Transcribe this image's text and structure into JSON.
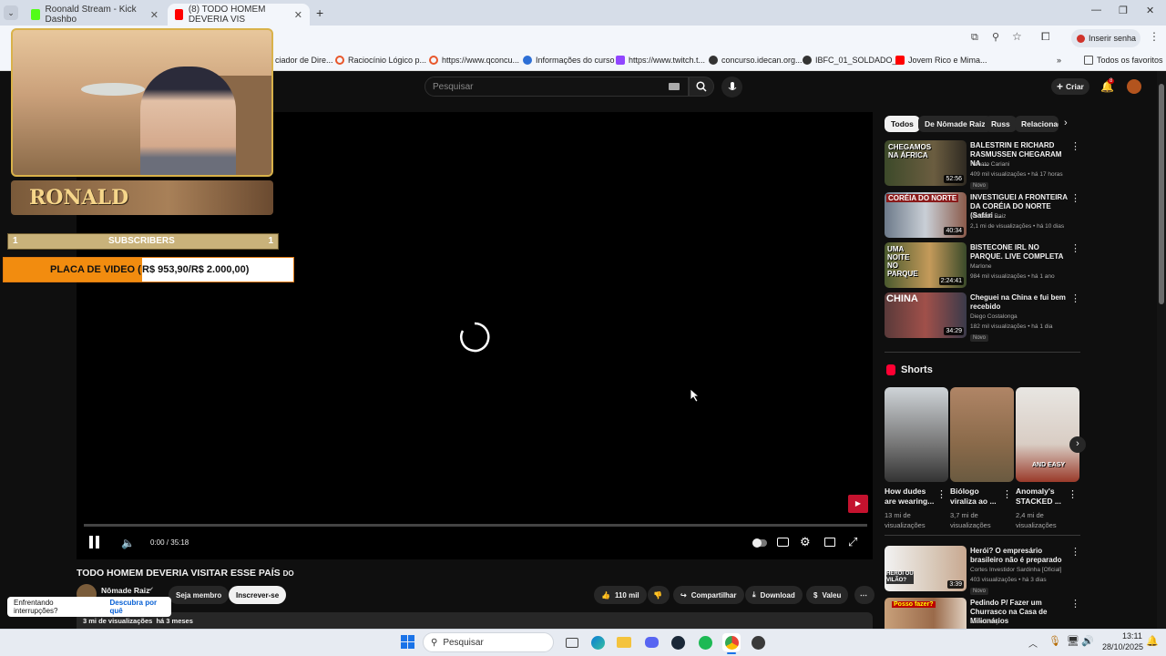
{
  "browser": {
    "tabs": [
      {
        "label": "Roonald Stream - Kick Dashbo",
        "active": false
      },
      {
        "label": "(8) TODO HOMEM DEVERIA VIS",
        "active": true
      }
    ],
    "new_tab": "+",
    "insert_password": "Inserir senha",
    "bookmarks": [
      "ciador de Dire...",
      "Raciocínio Lógico p...",
      "https://www.qconcu...",
      "Informações do curso",
      "https://www.twitch.t...",
      "concurso.idecan.org...",
      "IBFC_01_SOLDADO_...",
      "Jovem Rico e Mima..."
    ],
    "all_favorites": "Todos os favoritos",
    "more_bookmarks": "»"
  },
  "overlay": {
    "streamer_name": "RONALD",
    "subscribers_left": "1",
    "subscribers_label": "SUBSCRIBERS",
    "subscribers_right": "1",
    "goal_label": "PLACA DE VIDEO (",
    "goal_value": "R$ 953,90/R$ 2.000,00)",
    "goal_progress": 0.477
  },
  "youtube": {
    "search_placeholder": "Pesquisar",
    "create_label": "Criar",
    "notif_count": "8",
    "player": {
      "time": "0:00 / 35:18"
    },
    "video": {
      "title": "TODO HOMEM DEVERIA VISITAR ESSE PAÍS ",
      "title_suffix": "DO",
      "channel": "Nômade Raiz",
      "join": "Seja membro",
      "subscribe": "Inscrever-se",
      "likes": "110 mil",
      "share": "Compartilhar",
      "download": "Download",
      "thanks": "Valeu",
      "meta": "3 mi de visualizações  há 3 meses"
    },
    "toast": {
      "text": "Enfrentando interrupções?",
      "link": "Descubra por quê"
    },
    "chips": [
      "Todos",
      "De Nômade Raiz",
      "Russ",
      "Relacionad"
    ],
    "related": [
      {
        "title": "BALESTRIN E RICHARD RASMUSSEN CHEGARAM NA ...",
        "channel": "Renato Cariani",
        "views": "409 mil visualizações • há 17 horas",
        "badge": "Novo",
        "duration": "52:56",
        "thumb_text": "CHEGAMOS NA ÁFRICA"
      },
      {
        "title": "INVESTIGUEI A FRONTEIRA DA CORÉIA DO NORTE (Safári ...",
        "channel": "Nômade Raiz",
        "views": "2,1 mi de visualizações • há 10 dias",
        "badge": "",
        "duration": "40:34",
        "thumb_text": "CORÉIA DO NORTE"
      },
      {
        "title": "BISTECONE IRL NO PARQUE. LIVE COMPLETA",
        "channel": "Marlone",
        "views": "984 mil visualizações • há 1 ano",
        "badge": "",
        "duration": "2:24:41",
        "thumb_text": "UMA NOITE NO PARQUE"
      },
      {
        "title": "Cheguei na China e fui bem recebido",
        "channel": "Diego Costalonga",
        "views": "182 mil visualizações • há 1 dia",
        "badge": "Novo",
        "duration": "34:29",
        "thumb_text": "CHINA"
      }
    ],
    "shorts_label": "Shorts",
    "shorts": [
      {
        "title": "How dudes are wearing...",
        "views": "13 mi de visualizações"
      },
      {
        "title": "Biólogo viraliza ao ...",
        "views": "3,7 mi de visualizações"
      },
      {
        "title": "Anomaly's STACKED ...",
        "views": "2,4 mi de visualizações",
        "thumb_text": "AND EASY"
      }
    ],
    "related_bottom": [
      {
        "title": "Herói? O empresário brasileiro não é preparado",
        "channel": "Cortes Investidor Sardinha [Oficial]",
        "views": "403 visualizações • há 3 dias",
        "badge": "Novo",
        "duration": "3:39",
        "thumb_text": "HERÓI OU VILÃO?"
      },
      {
        "title": "Pedindo P/ Fazer um Churrasco na Casa de Milionários",
        "channel": "Joao Curry",
        "views": "",
        "badge": "",
        "duration": "",
        "thumb_text": "Posso fazer?"
      }
    ]
  },
  "taskbar": {
    "search_label": "Pesquisar",
    "time": "13:11",
    "date": "28/10/2025"
  }
}
